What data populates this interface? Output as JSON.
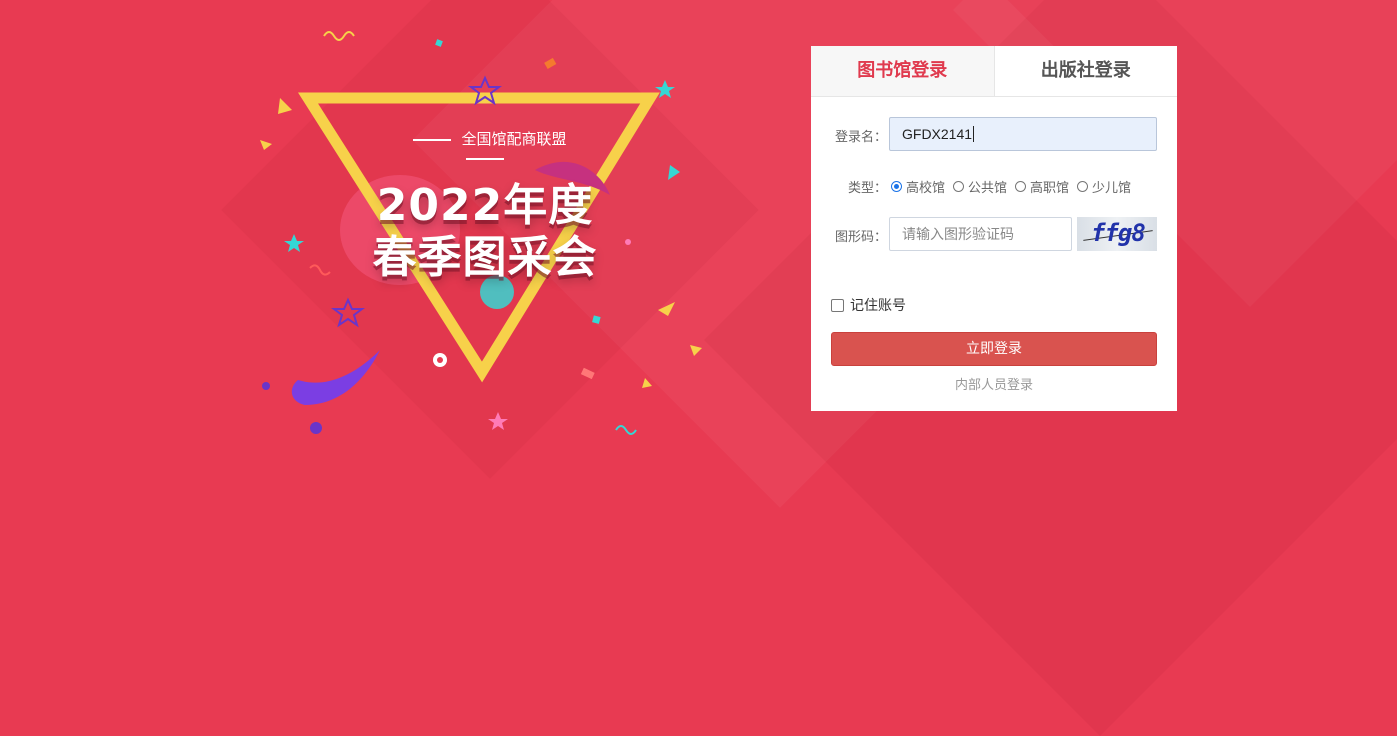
{
  "hero": {
    "subtitle": "全国馆配商联盟",
    "title_line1": "2022年度",
    "title_line2": "春季图采会"
  },
  "tabs": [
    {
      "label": "图书馆登录",
      "active": true
    },
    {
      "label": "出版社登录",
      "active": false
    }
  ],
  "form": {
    "username_label": "登录名：",
    "username_value": "GFDX2141",
    "type_label": "类型：",
    "types": [
      {
        "label": "高校馆",
        "checked": true
      },
      {
        "label": "公共馆",
        "checked": false
      },
      {
        "label": "高职馆",
        "checked": false
      },
      {
        "label": "少儿馆",
        "checked": false
      }
    ],
    "captcha_label": "图形码：",
    "captcha_placeholder": "请输入图形验证码",
    "captcha_text": "ffg8",
    "remember_label": "记住账号",
    "remember_checked": false,
    "submit_label": "立即登录",
    "staff_login_label": "内部人员登录"
  },
  "colors": {
    "background": "#e83a52",
    "active_tab": "#e03a4e",
    "submit_button": "#d9534f",
    "triangle": "#f7d14a"
  }
}
